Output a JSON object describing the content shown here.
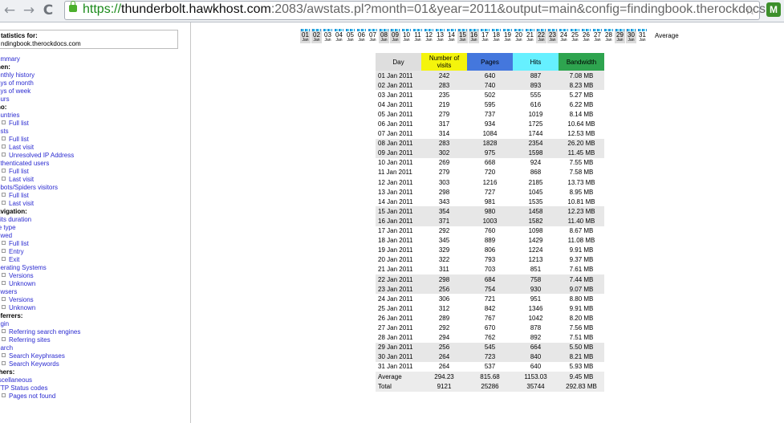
{
  "browser": {
    "url_scheme": "https://",
    "url_host": "thunderbolt.hawkhost.com",
    "url_rest": ":2083/awstats.pl?month=01&year=2011&output=main&config=findingbook.therockdocs.",
    "back_icon": "back-arrow-icon",
    "forward_icon": "forward-arrow-icon",
    "reload_icon": "reload-icon",
    "back_glyph": "←",
    "forward_glyph": "→",
    "reload_glyph": "C",
    "star_glyph": "☆",
    "ext_glyph": "M"
  },
  "sidebar": {
    "stats_label": "tatistics for:",
    "site_name": "ndingbook.therockdocs.com",
    "items": [
      {
        "label": "ummary",
        "style": "link"
      },
      {
        "label": "hen:",
        "style": "bold"
      },
      {
        "label": "onthly history",
        "style": "link"
      },
      {
        "label": "ays of month",
        "style": "link"
      },
      {
        "label": "ays of week",
        "style": "link"
      },
      {
        "label": "ours",
        "style": "link"
      },
      {
        "label": "ho:",
        "style": "bold"
      },
      {
        "label": "ountries",
        "style": "link"
      },
      {
        "label": "Full list",
        "style": "sub"
      },
      {
        "label": "osts",
        "style": "link"
      },
      {
        "label": "Full list",
        "style": "sub"
      },
      {
        "label": "Last visit",
        "style": "sub"
      },
      {
        "label": "Unresolved IP Address",
        "style": "sub"
      },
      {
        "label": "uthenticated users",
        "style": "link"
      },
      {
        "label": "Full list",
        "style": "sub"
      },
      {
        "label": "Last visit",
        "style": "sub"
      },
      {
        "label": "obots/Spiders visitors",
        "style": "link"
      },
      {
        "label": "Full list",
        "style": "sub"
      },
      {
        "label": "Last visit",
        "style": "sub"
      },
      {
        "label": "avigation:",
        "style": "bold"
      },
      {
        "label": "sits duration",
        "style": "link"
      },
      {
        "label": "le type",
        "style": "link"
      },
      {
        "label": "ewed",
        "style": "link"
      },
      {
        "label": "Full list",
        "style": "sub"
      },
      {
        "label": "Entry",
        "style": "sub"
      },
      {
        "label": "Exit",
        "style": "sub"
      },
      {
        "label": "perating Systems",
        "style": "link"
      },
      {
        "label": "Versions",
        "style": "sub"
      },
      {
        "label": "Unknown",
        "style": "sub"
      },
      {
        "label": "owsers",
        "style": "link"
      },
      {
        "label": "Versions",
        "style": "sub"
      },
      {
        "label": "Unknown",
        "style": "sub"
      },
      {
        "label": "eferrers:",
        "style": "bold"
      },
      {
        "label": "rigin",
        "style": "link"
      },
      {
        "label": "Referring search engines",
        "style": "sub"
      },
      {
        "label": "Referring sites",
        "style": "sub"
      },
      {
        "label": "earch",
        "style": "link"
      },
      {
        "label": "Search Keyphrases",
        "style": "sub"
      },
      {
        "label": "Search Keywords",
        "style": "sub"
      },
      {
        "label": "thers:",
        "style": "bold"
      },
      {
        "label": "iscellaneous",
        "style": "link"
      },
      {
        "label": "TTP Status codes",
        "style": "link"
      },
      {
        "label": "Pages not found",
        "style": "sub"
      }
    ]
  },
  "daybar": {
    "month_label": "Jan",
    "average_label": "Average",
    "days": [
      "01",
      "02",
      "03",
      "04",
      "05",
      "06",
      "07",
      "08",
      "09",
      "10",
      "11",
      "12",
      "13",
      "14",
      "15",
      "16",
      "17",
      "18",
      "19",
      "20",
      "21",
      "22",
      "23",
      "24",
      "25",
      "26",
      "27",
      "28",
      "29",
      "30",
      "31"
    ],
    "weekend_days": [
      "01",
      "02",
      "08",
      "09",
      "15",
      "16",
      "22",
      "23",
      "29",
      "30"
    ]
  },
  "table": {
    "headers": {
      "day": "Day",
      "visits": "Number of visits",
      "pages": "Pages",
      "hits": "Hits",
      "bandwidth": "Bandwidth"
    },
    "header_colors": {
      "day": "#dedede",
      "visits": "#f4f40c",
      "pages": "#4477dd",
      "hits": "#66f0ff",
      "bandwidth": "#2ea44f"
    },
    "rows": [
      {
        "day": "01 Jan 2011",
        "visits": "242",
        "pages": "640",
        "hits": "887",
        "bw": "7.08 MB",
        "we": true
      },
      {
        "day": "02 Jan 2011",
        "visits": "283",
        "pages": "740",
        "hits": "893",
        "bw": "8.23 MB",
        "we": true
      },
      {
        "day": "03 Jan 2011",
        "visits": "235",
        "pages": "502",
        "hits": "555",
        "bw": "5.27 MB",
        "we": false
      },
      {
        "day": "04 Jan 2011",
        "visits": "219",
        "pages": "595",
        "hits": "616",
        "bw": "6.22 MB",
        "we": false
      },
      {
        "day": "05 Jan 2011",
        "visits": "279",
        "pages": "737",
        "hits": "1019",
        "bw": "8.14 MB",
        "we": false
      },
      {
        "day": "06 Jan 2011",
        "visits": "317",
        "pages": "934",
        "hits": "1725",
        "bw": "10.64 MB",
        "we": false
      },
      {
        "day": "07 Jan 2011",
        "visits": "314",
        "pages": "1084",
        "hits": "1744",
        "bw": "12.53 MB",
        "we": false
      },
      {
        "day": "08 Jan 2011",
        "visits": "283",
        "pages": "1828",
        "hits": "2354",
        "bw": "26.20 MB",
        "we": true
      },
      {
        "day": "09 Jan 2011",
        "visits": "302",
        "pages": "975",
        "hits": "1598",
        "bw": "11.45 MB",
        "we": true
      },
      {
        "day": "10 Jan 2011",
        "visits": "269",
        "pages": "668",
        "hits": "924",
        "bw": "7.55 MB",
        "we": false
      },
      {
        "day": "11 Jan 2011",
        "visits": "279",
        "pages": "720",
        "hits": "868",
        "bw": "7.58 MB",
        "we": false
      },
      {
        "day": "12 Jan 2011",
        "visits": "303",
        "pages": "1216",
        "hits": "2185",
        "bw": "13.73 MB",
        "we": false
      },
      {
        "day": "13 Jan 2011",
        "visits": "298",
        "pages": "727",
        "hits": "1045",
        "bw": "8.95 MB",
        "we": false
      },
      {
        "day": "14 Jan 2011",
        "visits": "343",
        "pages": "981",
        "hits": "1535",
        "bw": "10.81 MB",
        "we": false
      },
      {
        "day": "15 Jan 2011",
        "visits": "354",
        "pages": "980",
        "hits": "1458",
        "bw": "12.23 MB",
        "we": true
      },
      {
        "day": "16 Jan 2011",
        "visits": "371",
        "pages": "1003",
        "hits": "1582",
        "bw": "11.40 MB",
        "we": true
      },
      {
        "day": "17 Jan 2011",
        "visits": "292",
        "pages": "760",
        "hits": "1098",
        "bw": "8.67 MB",
        "we": false
      },
      {
        "day": "18 Jan 2011",
        "visits": "345",
        "pages": "889",
        "hits": "1429",
        "bw": "11.08 MB",
        "we": false
      },
      {
        "day": "19 Jan 2011",
        "visits": "329",
        "pages": "806",
        "hits": "1224",
        "bw": "9.91 MB",
        "we": false
      },
      {
        "day": "20 Jan 2011",
        "visits": "322",
        "pages": "793",
        "hits": "1213",
        "bw": "9.37 MB",
        "we": false
      },
      {
        "day": "21 Jan 2011",
        "visits": "311",
        "pages": "703",
        "hits": "851",
        "bw": "7.61 MB",
        "we": false
      },
      {
        "day": "22 Jan 2011",
        "visits": "298",
        "pages": "684",
        "hits": "758",
        "bw": "7.44 MB",
        "we": true
      },
      {
        "day": "23 Jan 2011",
        "visits": "256",
        "pages": "754",
        "hits": "930",
        "bw": "9.07 MB",
        "we": true
      },
      {
        "day": "24 Jan 2011",
        "visits": "306",
        "pages": "721",
        "hits": "951",
        "bw": "8.80 MB",
        "we": false
      },
      {
        "day": "25 Jan 2011",
        "visits": "312",
        "pages": "842",
        "hits": "1346",
        "bw": "9.91 MB",
        "we": false
      },
      {
        "day": "26 Jan 2011",
        "visits": "289",
        "pages": "767",
        "hits": "1042",
        "bw": "8.20 MB",
        "we": false
      },
      {
        "day": "27 Jan 2011",
        "visits": "292",
        "pages": "670",
        "hits": "878",
        "bw": "7.56 MB",
        "we": false
      },
      {
        "day": "28 Jan 2011",
        "visits": "294",
        "pages": "762",
        "hits": "892",
        "bw": "7.51 MB",
        "we": false
      },
      {
        "day": "29 Jan 2011",
        "visits": "256",
        "pages": "545",
        "hits": "664",
        "bw": "5.50 MB",
        "we": true
      },
      {
        "day": "30 Jan 2011",
        "visits": "264",
        "pages": "723",
        "hits": "840",
        "bw": "8.21 MB",
        "we": true
      },
      {
        "day": "31 Jan 2011",
        "visits": "264",
        "pages": "537",
        "hits": "640",
        "bw": "5.93 MB",
        "we": false
      }
    ],
    "summary": [
      {
        "day": "Average",
        "visits": "294.23",
        "pages": "815.68",
        "hits": "1153.03",
        "bw": "9.45 MB"
      },
      {
        "day": "Total",
        "visits": "9121",
        "pages": "25286",
        "hits": "35744",
        "bw": "292.83 MB"
      }
    ]
  }
}
